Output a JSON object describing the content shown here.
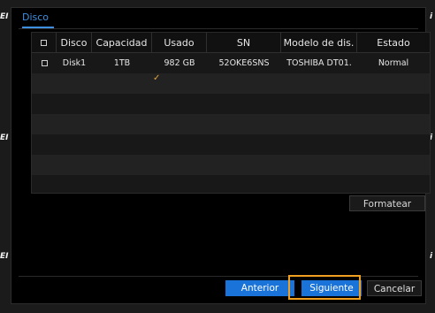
{
  "watermark": "EI",
  "dialog": {
    "tab_label": "Disco",
    "table": {
      "headers": [
        "Disco",
        "Capacidad",
        "Usado",
        "SN",
        "Modelo de dis.",
        "Estado"
      ],
      "rows": [
        {
          "disk": "Disk1",
          "capacity": "1TB",
          "used": "982 GB",
          "sn": "52OKE6SNS",
          "model": "TOSHIBA DT01.",
          "status": "Normal"
        }
      ]
    },
    "format_button": "Formatear",
    "prev_button": "Anterior",
    "next_button": "Siguiente",
    "cancel_button": "Cancelar",
    "checkmark": "✓"
  },
  "colors": {
    "accent": "#1a73d9",
    "tab": "#3d8fe0",
    "focus": "#f0a020"
  }
}
